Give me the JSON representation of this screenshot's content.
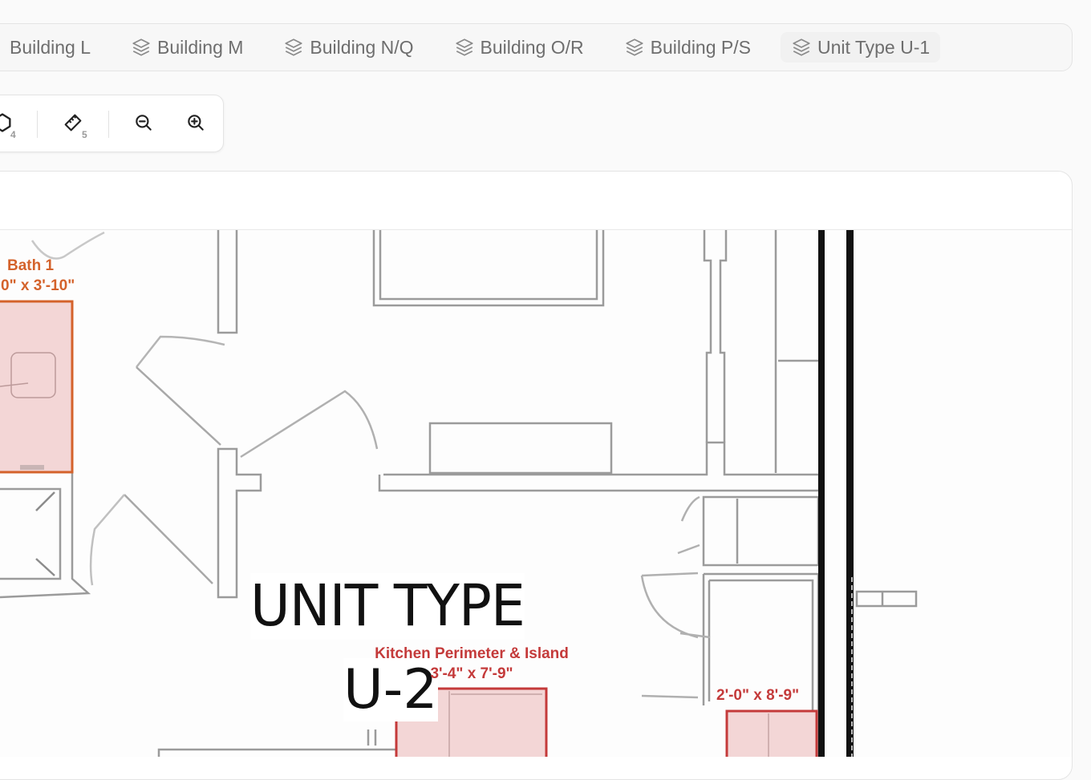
{
  "tabs": [
    {
      "label": "Building L",
      "icon": "layers-icon"
    },
    {
      "label": "Building M",
      "icon": "layers-icon"
    },
    {
      "label": "Building N/Q",
      "icon": "layers-icon"
    },
    {
      "label": "Building O/R",
      "icon": "layers-icon"
    },
    {
      "label": "Building P/S",
      "icon": "layers-icon"
    },
    {
      "label": "Unit Type U-1",
      "icon": "layers-icon"
    }
  ],
  "toolbar": {
    "polygon_hotkey": "4",
    "measure_hotkey": "5",
    "tools": [
      "polygon-icon",
      "ruler-icon",
      "zoom-out-icon",
      "zoom-in-icon"
    ]
  },
  "plan": {
    "unit_type_line1": "UNIT TYPE",
    "unit_type_line2": "U-2",
    "annotations": [
      {
        "name": "Bath 1",
        "dims": "0\" x 3'-10\"",
        "color": "#d4622b"
      },
      {
        "name": "Kitchen Perimeter & Island",
        "dims": "3'-4\" x 7'-9\"",
        "color": "#c43a3a"
      },
      {
        "name": "",
        "dims": "2'-0\" x 8'-9\"",
        "color": "#c43a3a"
      }
    ]
  },
  "colors": {
    "accent_red": "#c43a3a",
    "accent_orange": "#d4622b",
    "region_fill": "#f3d6d6"
  }
}
